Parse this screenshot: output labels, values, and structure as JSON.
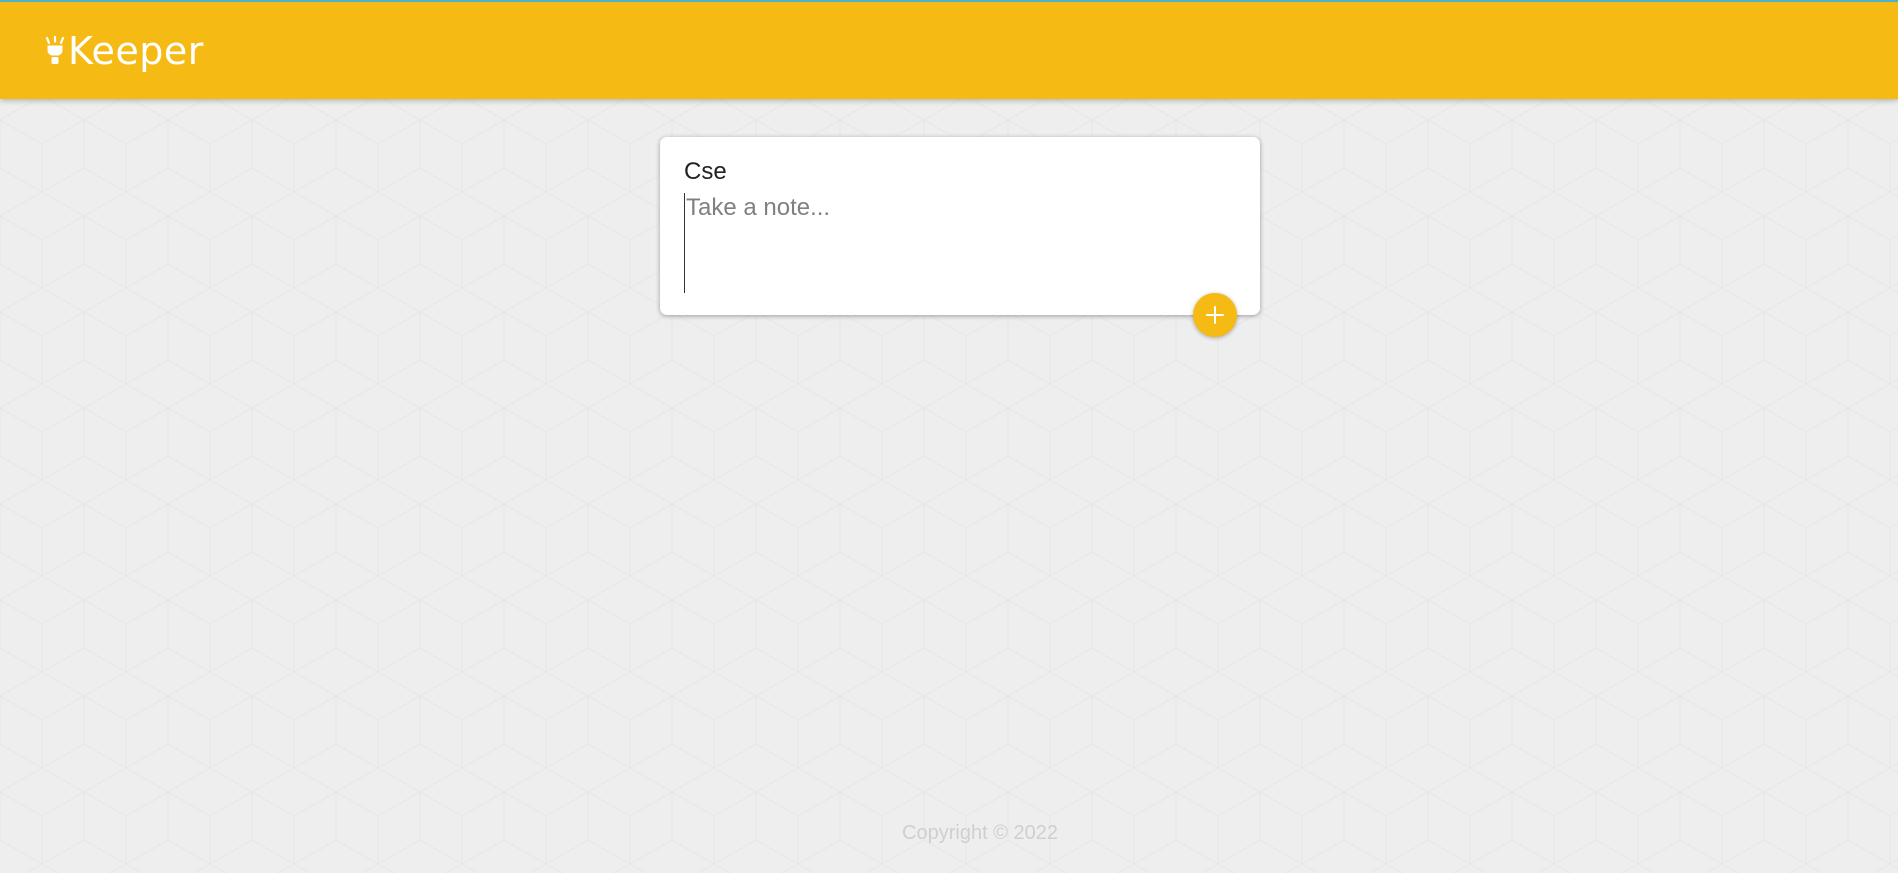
{
  "header": {
    "title": "Keeper",
    "icon": "lightbulb-icon"
  },
  "note_form": {
    "title_value": "Cse",
    "content_placeholder": "Take a note...",
    "add_button_icon": "plus-icon"
  },
  "footer": {
    "copyright": "Copyright © 2022"
  },
  "colors": {
    "brand": "#f5ba13",
    "background": "#eeeeee",
    "card": "#ffffff",
    "footer_text": "#cfcfcf",
    "header_top_border": "#4fb3c8"
  }
}
